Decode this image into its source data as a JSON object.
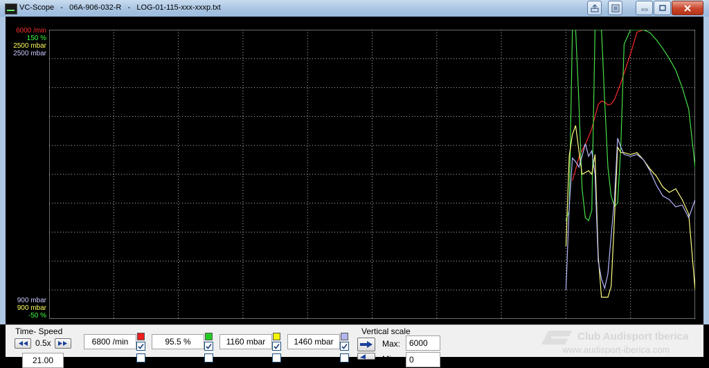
{
  "window": {
    "title": "VC-Scope   -   06A-906-032-R   -   LOG-01-115-xxx-xxxp.txt"
  },
  "scale_labels": {
    "top": [
      {
        "text": "6000 /min",
        "color": "#ff3030"
      },
      {
        "text": "150 %",
        "color": "#40ff40"
      },
      {
        "text": "2500 mbar",
        "color": "#ffff60"
      },
      {
        "text": "2500 mbar",
        "color": "#c8c8ff"
      }
    ],
    "bottom": [
      {
        "text": "900 mbar",
        "color": "#c8c8ff"
      },
      {
        "text": "900 mbar",
        "color": "#ffff60"
      },
      {
        "text": "-50 %",
        "color": "#40ff40"
      }
    ]
  },
  "chart_data": {
    "type": "line",
    "grid": true,
    "background": "#000000",
    "x": [
      0.781,
      0.785,
      0.79,
      0.795,
      0.8,
      0.805,
      0.81,
      0.815,
      0.82,
      0.825,
      0.83,
      0.835,
      0.84,
      0.845,
      0.85,
      0.855,
      0.86,
      0.865,
      0.87,
      0.875,
      0.88,
      0.885,
      0.89,
      0.9,
      0.91,
      0.92,
      0.93,
      0.94,
      0.95,
      0.96,
      0.97,
      0.98,
      0.99,
      1.0
    ],
    "series": [
      {
        "color": "#ff2a2a",
        "y_scale": [
          0,
          6000
        ],
        "values": [
          null,
          null,
          null,
          null,
          null,
          null,
          2870,
          3100,
          3350,
          3500,
          3620,
          3780,
          3950,
          4200,
          4450,
          4520,
          4500,
          4440,
          4460,
          4550,
          4720,
          4900,
          5100,
          5500,
          5950,
          6400,
          null,
          null,
          null,
          null,
          null,
          null,
          null,
          null
        ]
      },
      {
        "color": "#48e048",
        "y_scale": [
          -50,
          150
        ],
        "values": [
          null,
          null,
          null,
          null,
          18,
          25,
          160,
          160,
          100,
          40,
          20,
          18,
          25,
          160,
          160,
          160,
          100,
          55,
          35,
          28,
          30,
          70,
          140,
          160,
          160,
          152,
          148,
          143,
          137,
          130,
          122,
          110,
          95,
          55
        ]
      },
      {
        "color": "#ffff80",
        "y_scale": [
          900,
          2500
        ],
        "values": [
          null,
          null,
          null,
          null,
          1300,
          1800,
          1920,
          1970,
          1830,
          1700,
          1710,
          1720,
          1700,
          1810,
          1250,
          1020,
          1020,
          1020,
          1080,
          1450,
          1850,
          1820,
          1820,
          1810,
          1820,
          1780,
          1730,
          1690,
          1630,
          1600,
          1620,
          1560,
          1480,
          1060
        ]
      },
      {
        "color": "#b8b8ff",
        "y_scale": [
          900,
          2500
        ],
        "values": [
          null,
          null,
          null,
          null,
          1060,
          1520,
          1790,
          1770,
          1740,
          1800,
          1870,
          1800,
          1830,
          1700,
          1220,
          1120,
          1070,
          1150,
          1360,
          1560,
          1900,
          1850,
          1810,
          1800,
          1810,
          1780,
          1720,
          1640,
          1580,
          1560,
          1520,
          1530,
          1460,
          1560
        ]
      }
    ]
  },
  "panel": {
    "time_speed": {
      "label": "Time- Speed",
      "value": "0.5x",
      "next_value": "21.00"
    },
    "channels": [
      {
        "value": "6800 /min",
        "color": "#ee1c1c"
      },
      {
        "value": "95.5 %",
        "color": "#22cc22"
      },
      {
        "value": "1160 mbar",
        "color": "#f5f500"
      },
      {
        "value": "1460 mbar",
        "color": "#b4b4ee"
      }
    ],
    "vertical_scale": {
      "label": "Vertical scale",
      "max_label": "Max:",
      "max_value": "6000",
      "min_label": "Min:",
      "min_value": "0"
    },
    "watermark": {
      "title": "Club Audisport Iberica",
      "url": "www.audisport-iberica.com"
    }
  }
}
